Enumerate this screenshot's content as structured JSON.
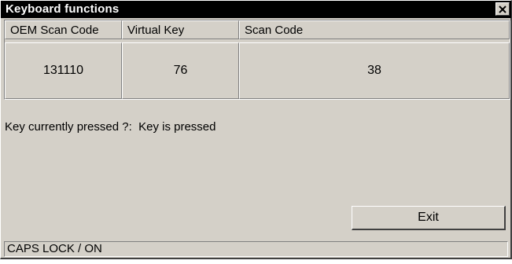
{
  "window": {
    "title": "Keyboard functions",
    "close_icon": "close-x-icon"
  },
  "table": {
    "columns": [
      "OEM Scan Code",
      "Virtual Key",
      "Scan Code"
    ],
    "row": [
      "131110",
      "76",
      "38"
    ]
  },
  "status": {
    "label": "Key currently pressed ?:",
    "value": "Key is pressed"
  },
  "buttons": {
    "exit_label": "Exit"
  },
  "statusbar": {
    "text": "CAPS LOCK / ON"
  },
  "colors": {
    "face": "#d4d0c8",
    "titlebar": "#000000",
    "title_text": "#ffffff"
  }
}
